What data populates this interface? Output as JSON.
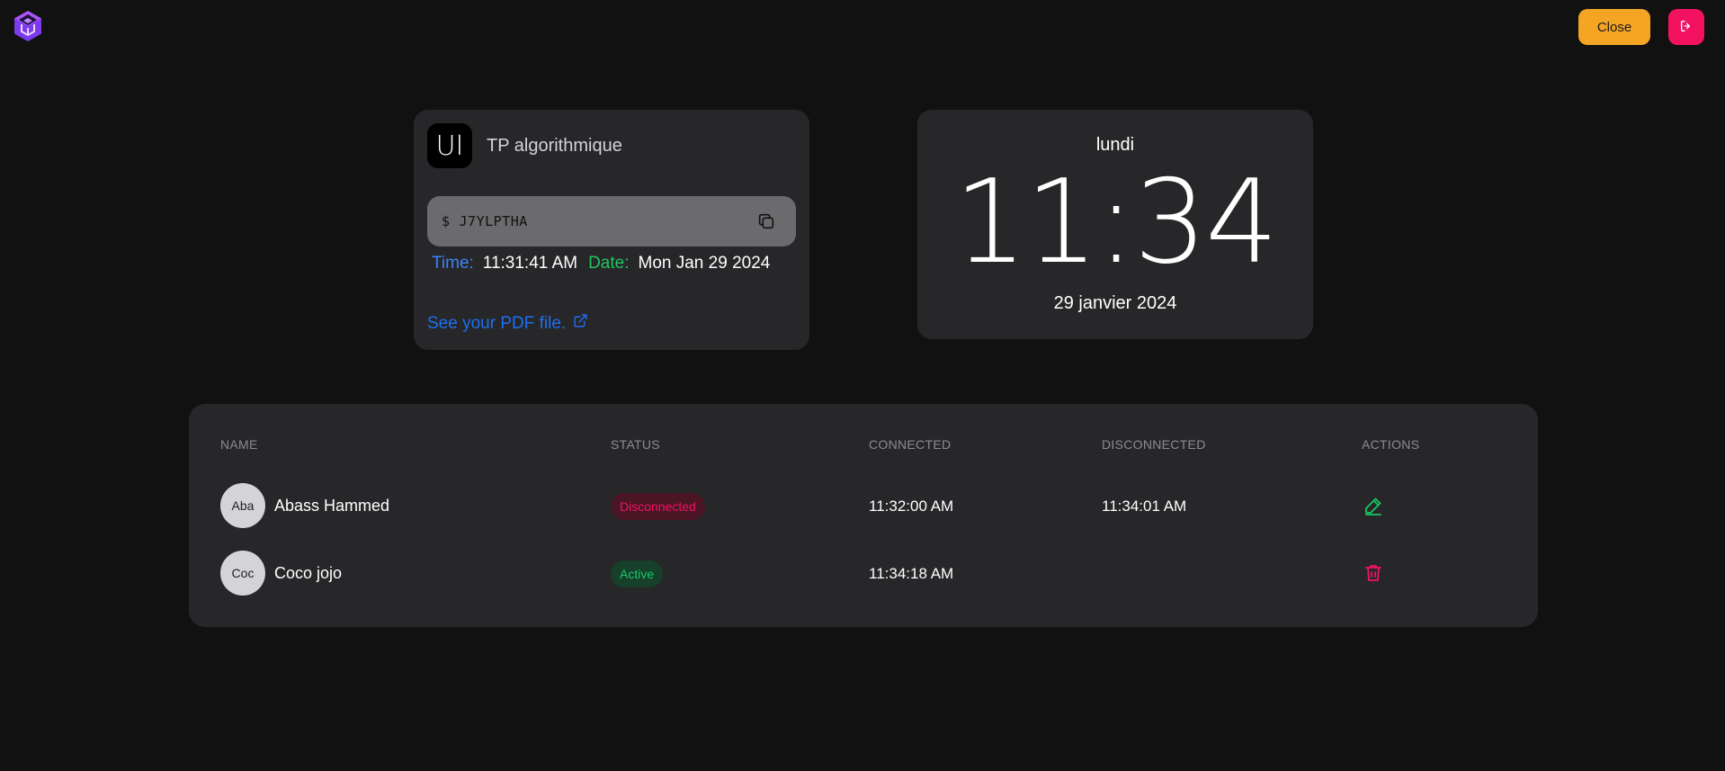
{
  "header": {
    "logo_icon": "cube-logo-icon",
    "close_label": "Close",
    "logout_icon": "logout-icon"
  },
  "session": {
    "avatar_text": "UI",
    "title": "TP algorithmique",
    "code_prefix": "$",
    "code": "J7YLPTHA",
    "copy_icon": "copy-icon",
    "time_label": "Time:",
    "time_value": "11:31:41 AM",
    "date_label": "Date:",
    "date_value": "Mon Jan 29 2024",
    "pdf_link": "See your PDF file.",
    "external_icon": "external-link-icon"
  },
  "clock": {
    "day": "lundi",
    "time": "11:34",
    "date": "29 janvier 2024"
  },
  "table": {
    "headers": [
      "NAME",
      "STATUS",
      "CONNECTED",
      "DISCONNECTED",
      "ACTIONS"
    ],
    "rows": [
      {
        "avatar": "Aba",
        "name": "Abass Hammed",
        "status": "Disconnected",
        "connected": "11:32:00 AM",
        "disconnected": "11:34:01 AM",
        "action_icon": "edit-icon"
      },
      {
        "avatar": "Coc",
        "name": "Coco jojo",
        "status": "Active",
        "connected": "11:34:18 AM",
        "disconnected": "",
        "action_icon": "trash-icon"
      }
    ]
  },
  "colors": {
    "background": "#111111",
    "card": "#27272a",
    "close_button": "#f5a524",
    "logout_button": "#f31260",
    "time_label": "#3b82f6",
    "date_label": "#22c55e",
    "link": "#1d6ff2",
    "status_disconnected": "#f31260",
    "status_active": "#17c964"
  }
}
